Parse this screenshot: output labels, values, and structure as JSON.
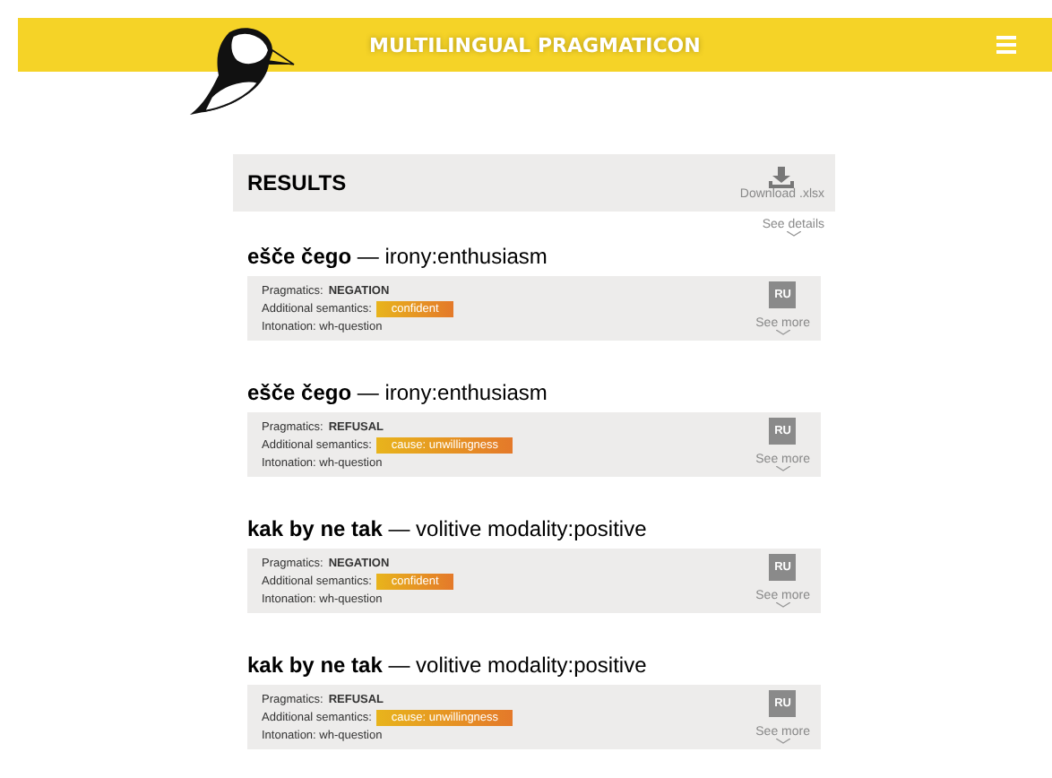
{
  "header": {
    "title": "MULTILINGUAL PRAGMATICON"
  },
  "results": {
    "heading": "RESULTS",
    "download": "Download .xlsx",
    "see_details": "See details"
  },
  "entries": [
    {
      "title": "**ešče čego** — irony:enthusiasm",
      "pragmatics_label": "Pragmatics:",
      "pragmatics": "NEGATION",
      "semantics_label": "Additional semantics:",
      "semantics": "confident",
      "intonation": "Intonation: wh-question",
      "language": "RU",
      "see_more": "See more"
    },
    {
      "title": "**ešče čego** — irony:enthusiasm",
      "pragmatics_label": "Pragmatics:",
      "pragmatics": "REFUSAL",
      "semantics_label": "Additional semantics:",
      "semantics": "cause: unwillingness",
      "intonation": "Intonation: wh-question",
      "language": "RU",
      "see_more": "See more"
    },
    {
      "title": "**kak by ne tak** — volitive modality:positive",
      "pragmatics_label": "Pragmatics:",
      "pragmatics": "NEGATION",
      "semantics_label": "Additional semantics:",
      "semantics": "confident",
      "intonation": "Intonation: wh-question",
      "language": "RU",
      "see_more": "See more"
    },
    {
      "title": "**kak by ne tak** — volitive modality:positive",
      "pragmatics_label": "Pragmatics:",
      "pragmatics": "REFUSAL",
      "semantics_label": "Additional semantics:",
      "semantics": "cause: unwillingness",
      "intonation": "Intonation: wh-question",
      "language": "RU",
      "see_more": "See more"
    }
  ]
}
